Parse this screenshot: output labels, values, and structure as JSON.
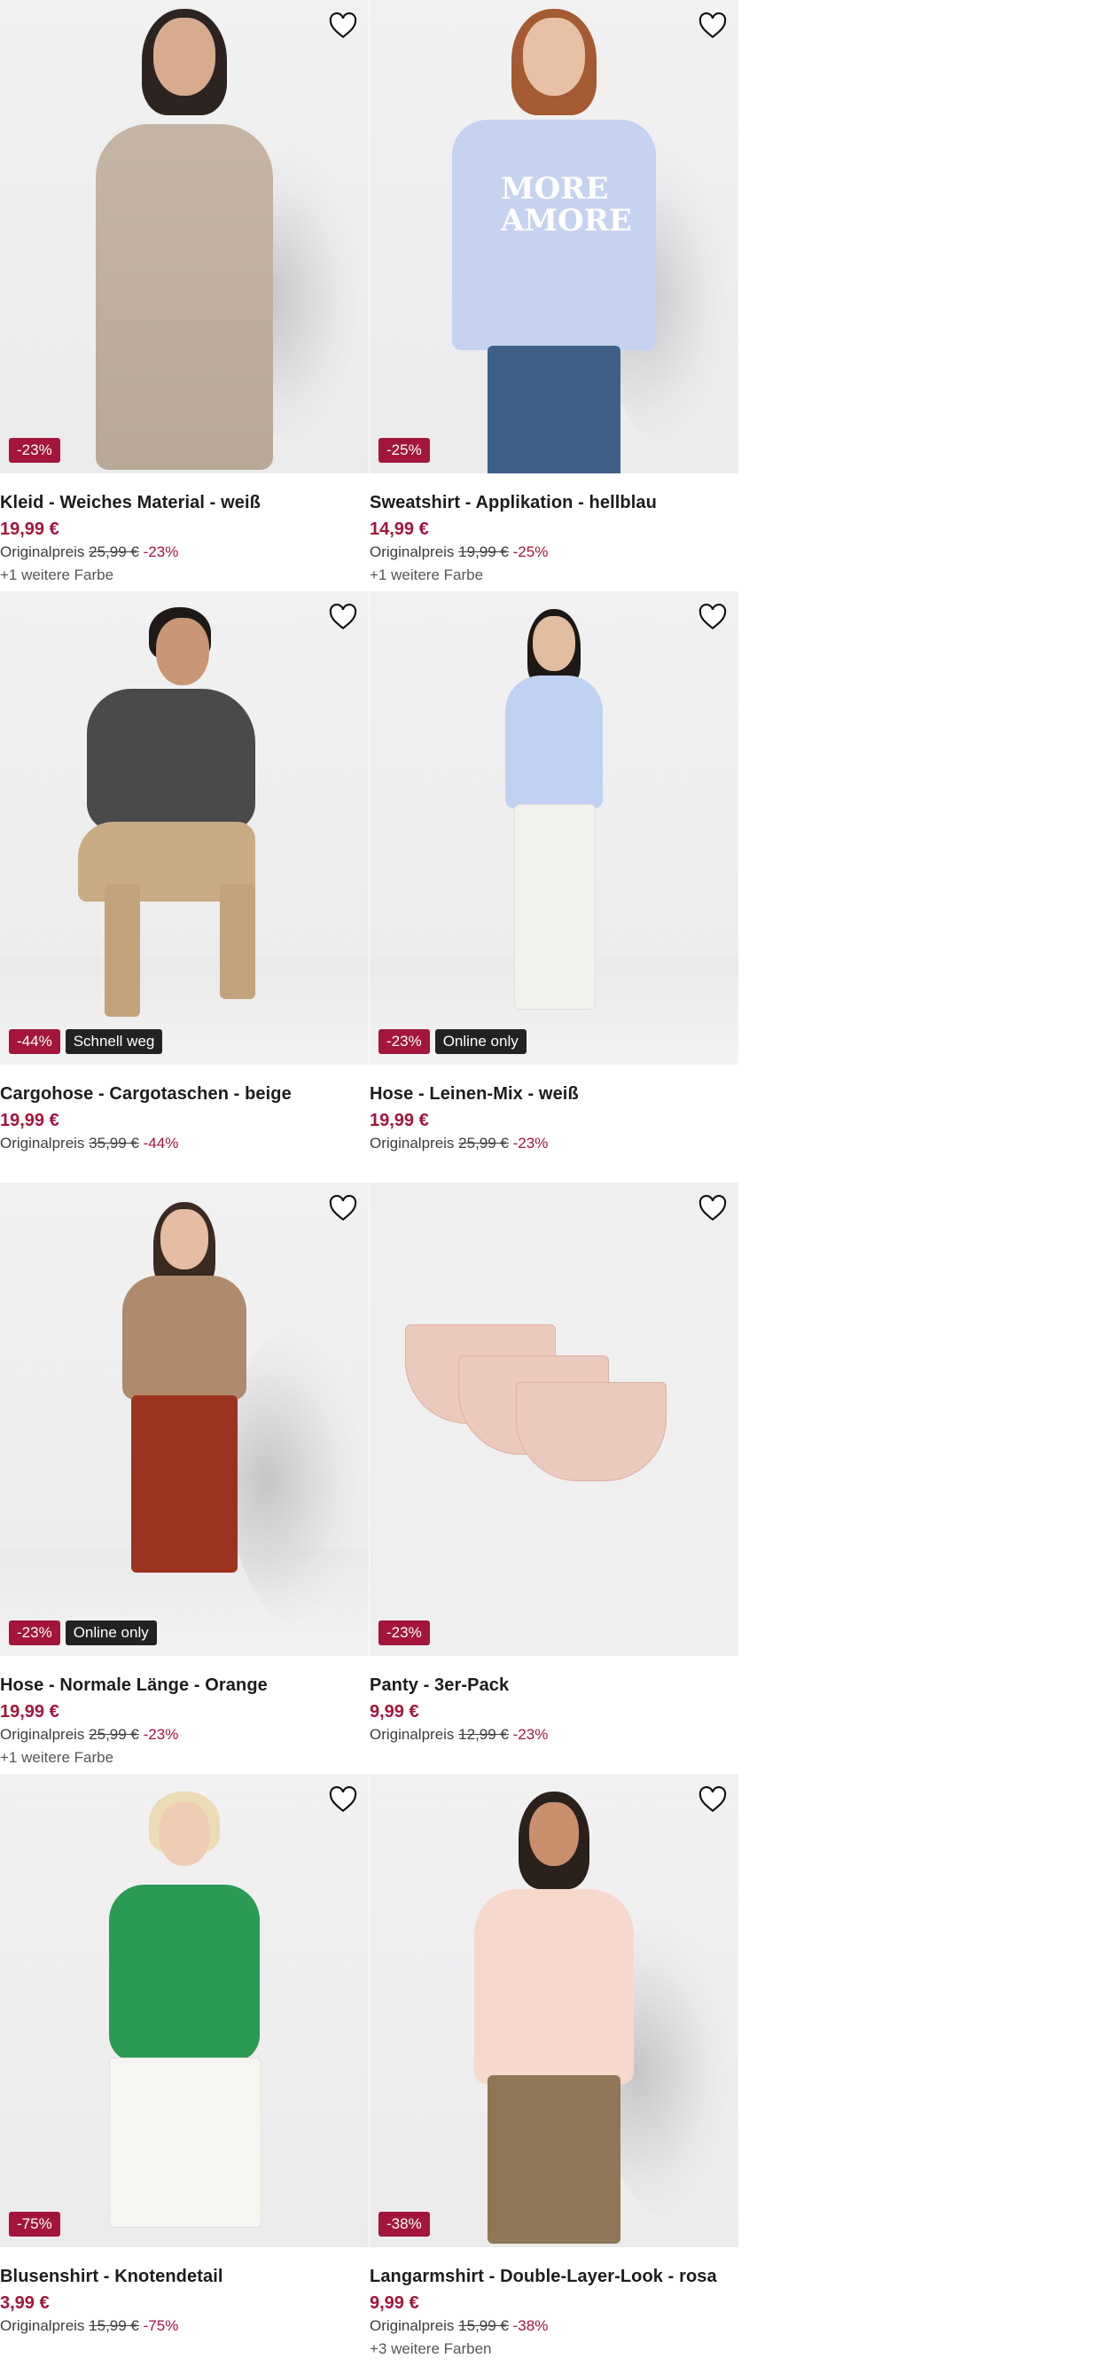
{
  "products": [
    {
      "title": "Kleid - Weiches Material - weiß",
      "price": "19,99 €",
      "original_label": "Originalpreis",
      "original_price": "25,99 €",
      "discount": "-23%",
      "badge": "-23%",
      "tag": "",
      "more_colors": "+1 weitere Farbe",
      "favorite_icon": "heart-outline-icon"
    },
    {
      "title": "Sweatshirt - Applikation - hellblau",
      "price": "14,99 €",
      "original_label": "Originalpreis",
      "original_price": "19,99 €",
      "discount": "-25%",
      "badge": "-25%",
      "tag": "",
      "more_colors": "+1 weitere Farbe",
      "print_text": "MORE AMORE",
      "favorite_icon": "heart-outline-icon"
    },
    {
      "title": "Cargohose - Cargotaschen - beige",
      "price": "19,99 €",
      "original_label": "Originalpreis",
      "original_price": "35,99 €",
      "discount": "-44%",
      "badge": "-44%",
      "tag": "Schnell weg",
      "more_colors": "",
      "favorite_icon": "heart-outline-icon"
    },
    {
      "title": "Hose - Leinen-Mix - weiß",
      "price": "19,99 €",
      "original_label": "Originalpreis",
      "original_price": "25,99 €",
      "discount": "-23%",
      "badge": "-23%",
      "tag": "Online only",
      "more_colors": "",
      "favorite_icon": "heart-outline-icon"
    },
    {
      "title": "Hose - Normale Länge - Orange",
      "price": "19,99 €",
      "original_label": "Originalpreis",
      "original_price": "25,99 €",
      "discount": "-23%",
      "badge": "-23%",
      "tag": "Online only",
      "more_colors": "+1 weitere Farbe",
      "favorite_icon": "heart-outline-icon"
    },
    {
      "title": "Panty - 3er-Pack",
      "price": "9,99 €",
      "original_label": "Originalpreis",
      "original_price": "12,99 €",
      "discount": "-23%",
      "badge": "-23%",
      "tag": "",
      "more_colors": "",
      "favorite_icon": "heart-outline-icon"
    },
    {
      "title": "Blusenshirt - Knotendetail",
      "price": "3,99 €",
      "original_label": "Originalpreis",
      "original_price": "15,99 €",
      "discount": "-75%",
      "badge": "-75%",
      "tag": "",
      "more_colors": "",
      "favorite_icon": "heart-outline-icon"
    },
    {
      "title": "Langarmshirt - Double-Layer-Look - rosa",
      "price": "9,99 €",
      "original_label": "Originalpreis",
      "original_price": "15,99 €",
      "discount": "-38%",
      "badge": "-38%",
      "tag": "",
      "more_colors": "+3 weitere Farben",
      "favorite_icon": "heart-outline-icon"
    }
  ],
  "colors": {
    "sale": "#a3153a",
    "tag_bg": "#222222",
    "text": "#1c1c1c"
  }
}
